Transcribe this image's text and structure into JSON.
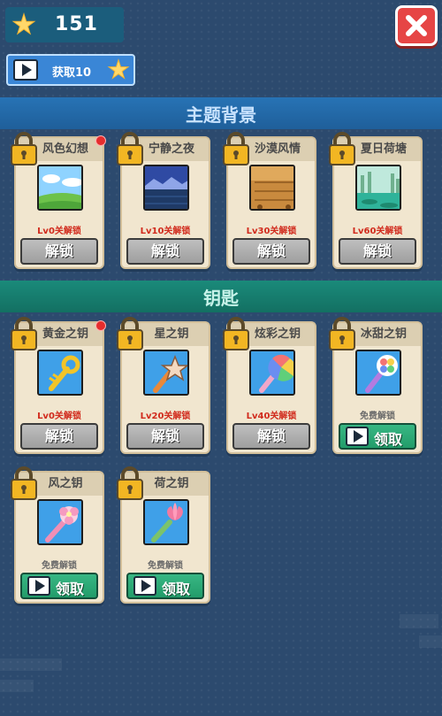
{
  "header": {
    "coin_count": "151",
    "get_button_label": "获取10"
  },
  "sections": {
    "backgrounds_title": "主题背景",
    "keys_title": "钥匙"
  },
  "backgrounds": [
    {
      "name": "风色幻想",
      "unlock": "Lv0关解锁",
      "button": "解锁"
    },
    {
      "name": "宁静之夜",
      "unlock": "Lv10关解锁",
      "button": "解锁"
    },
    {
      "name": "沙漠风情",
      "unlock": "Lv30关解锁",
      "button": "解锁"
    },
    {
      "name": "夏日荷塘",
      "unlock": "Lv60关解锁",
      "button": "解锁"
    }
  ],
  "keys": [
    {
      "name": "黄金之钥",
      "unlock": "Lv0关解锁",
      "button": "解锁"
    },
    {
      "name": "星之钥",
      "unlock": "Lv20关解锁",
      "button": "解锁"
    },
    {
      "name": "炫彩之钥",
      "unlock": "Lv40关解锁",
      "button": "解锁"
    },
    {
      "name": "冰甜之钥",
      "unlock": "免费解锁",
      "button": "领取"
    },
    {
      "name": "风之钥",
      "unlock": "免费解锁",
      "button": "领取"
    },
    {
      "name": "荷之钥",
      "unlock": "免费解锁",
      "button": "领取"
    }
  ],
  "colors": {
    "background": "#2c4a6e",
    "locked_text": "#d12b1d",
    "claim_green": "#229c6a",
    "close_red": "#e64545"
  }
}
